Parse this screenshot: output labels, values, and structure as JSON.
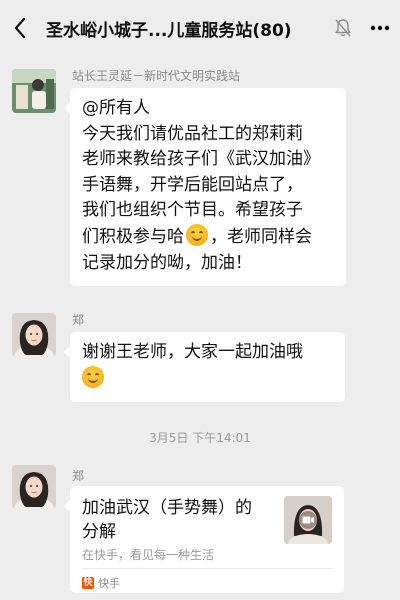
{
  "header": {
    "title": "圣水峪小城子...儿童服务站(80)",
    "back_icon": "back-chevron-icon",
    "mute_icon": "bell-muted-icon",
    "more_icon": "more-dots-icon"
  },
  "messages": [
    {
      "sender": "站长王灵延－新时代文明实践站",
      "lines": [
        "@所有人",
        "今天我们请优品社工的郑莉莉",
        "老师来教给孩子们《武汉加油》",
        "手语舞，开学后能回站点了，",
        "我们也组织个节目。希望孩子",
        "们积极参与哈",
        "，老师同样会",
        "记录加分的呦，加油！"
      ]
    },
    {
      "sender": "郑",
      "lines": [
        "谢谢王老师，大家一起加油哦"
      ]
    }
  ],
  "timestamp": "3月5日 下午14:01",
  "link_card": {
    "sender": "郑",
    "title_line1": "加油武汉（手势舞）的",
    "title_line2": "分解",
    "description": "在快手，看见每一种生活",
    "source_name": "快手",
    "source_logo_char": "快"
  }
}
